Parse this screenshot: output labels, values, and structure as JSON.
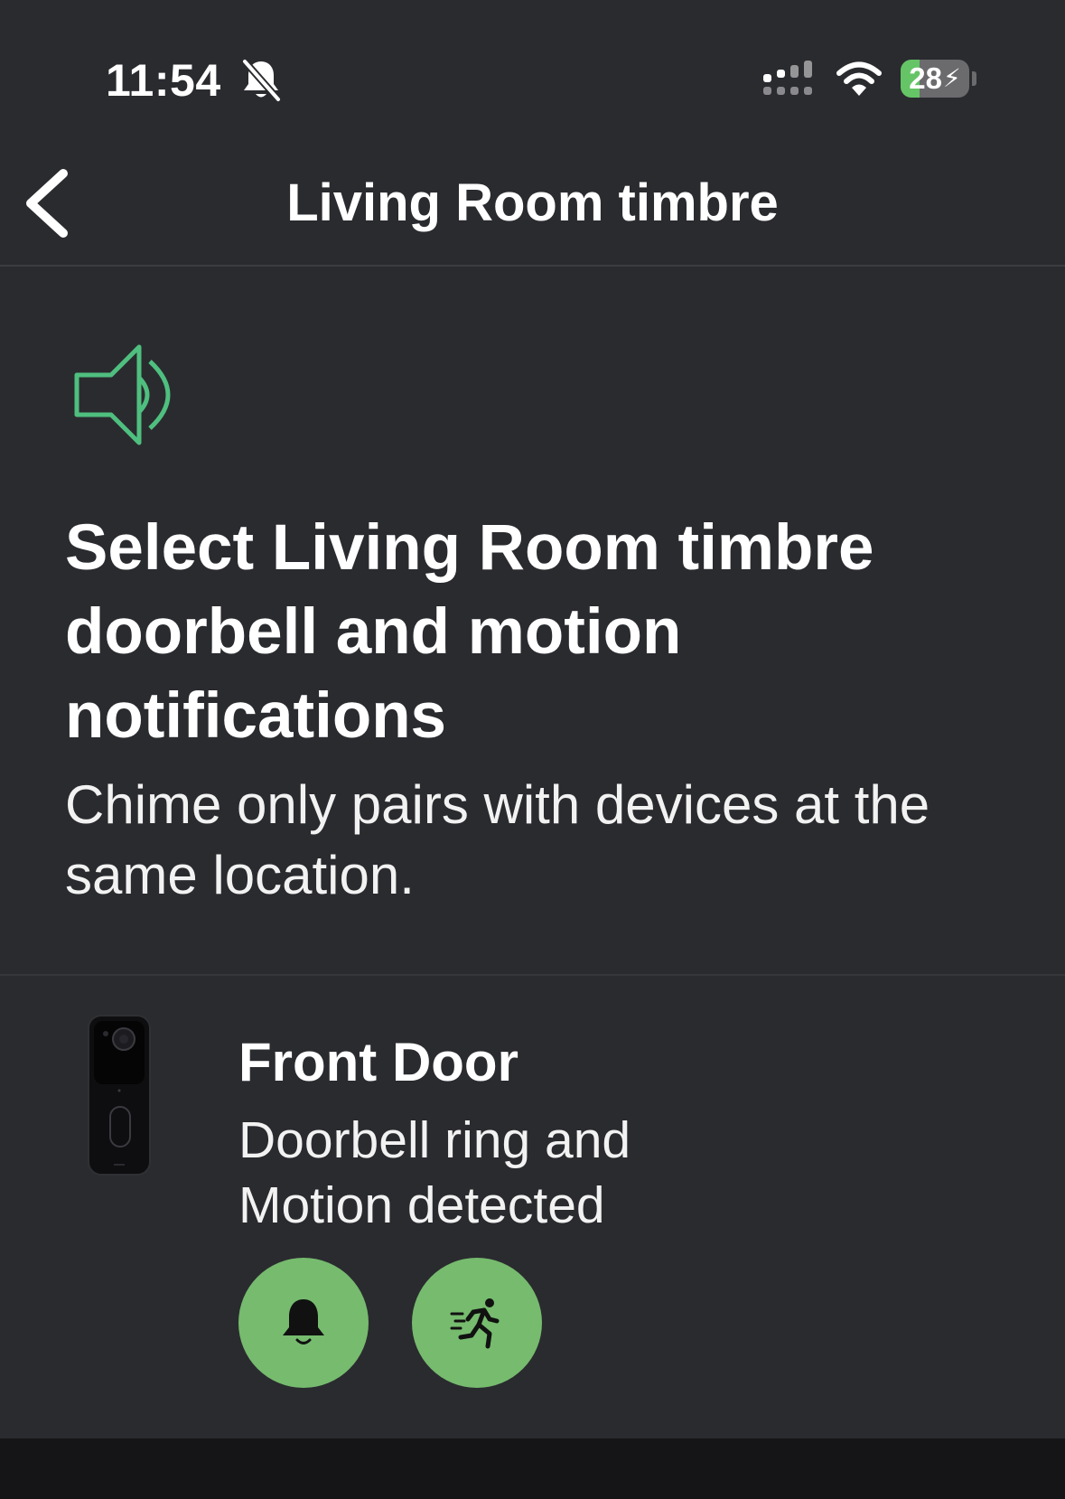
{
  "status_bar": {
    "time": "11:54",
    "battery_percent": "28",
    "battery_level": 0.28,
    "icons": [
      "bell-slash-icon",
      "cellular-signal-icon",
      "wifi-icon",
      "battery-charging-icon"
    ]
  },
  "nav": {
    "back_icon": "chevron-left-icon",
    "title": "Living Room timbre"
  },
  "header": {
    "icon": "speaker-icon",
    "title": "Select Living Room timbre doorbell and motion notifications",
    "subtitle": "Chime only pairs with devices at the same location."
  },
  "devices": [
    {
      "image": "doorbell-device-image",
      "name": "Front Door",
      "description": "Doorbell ring and Motion detected",
      "buttons": [
        {
          "icon": "bell-icon",
          "active": true
        },
        {
          "icon": "running-person-icon",
          "active": true
        }
      ]
    }
  ],
  "colors": {
    "background": "#2a2b2f",
    "accent_green": "#76bb6e",
    "speaker_icon_green": "#4fbf7f",
    "battery_green": "#65c466"
  }
}
